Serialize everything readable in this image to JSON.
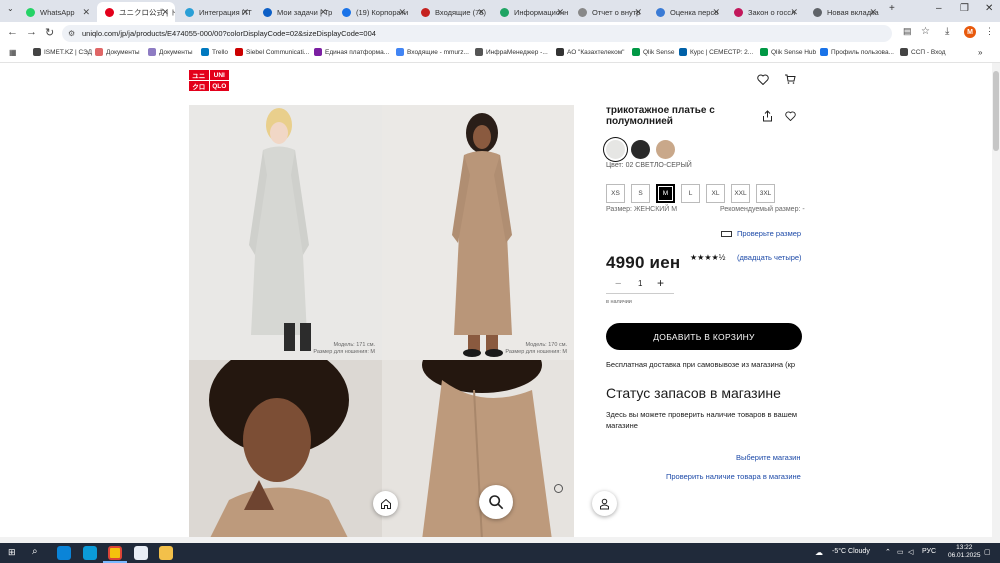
{
  "browser": {
    "tabs": [
      {
        "label": "WhatsApp",
        "color": "#25d366"
      },
      {
        "label": "ユニクロ公式 | ト",
        "color": "#e3001b"
      },
      {
        "label": "Интеграция ИТ",
        "color": "#2a9fd6"
      },
      {
        "label": "Мои задачи | Тр",
        "color": "#0d5fc6"
      },
      {
        "label": "(19) Корпорати",
        "color": "#1a73e8"
      },
      {
        "label": "Входящие (76)",
        "color": "#c5221f"
      },
      {
        "label": "Информационн",
        "color": "#1fa463"
      },
      {
        "label": "Отчет о внутр",
        "color": "#888888"
      },
      {
        "label": "Оценка персо",
        "color": "#3a7bd5"
      },
      {
        "label": "Закон о госсл",
        "color": "#c2185b"
      },
      {
        "label": "Новая вкладка",
        "color": "#5f6368"
      }
    ],
    "url": "uniqlo.com/jp/ja/products/E474055-000/00?colorDisplayCode=02&sizeDisplayCode=004",
    "profile_initial": "M",
    "bookmarks": [
      {
        "label": "ISMET.KZ | СЭД",
        "color": "#444444"
      },
      {
        "label": "Документы",
        "color": "#e06666"
      },
      {
        "label": "Документы",
        "color": "#8e7cc3"
      },
      {
        "label": "Trello",
        "color": "#0079bf"
      },
      {
        "label": "Siebel Communicati...",
        "color": "#cc0000"
      },
      {
        "label": "Единая платформа...",
        "color": "#7b1fa2"
      },
      {
        "label": "Входящие - mmurz...",
        "color": "#4285f4"
      },
      {
        "label": "ИнфраМенеджер -...",
        "color": "#555555"
      },
      {
        "label": "АО \"Казахтелеком\"",
        "color": "#333333"
      },
      {
        "label": "Qlik Sense",
        "color": "#009845"
      },
      {
        "label": "Курс | СЕМЕСТР: 2...",
        "color": "#0061a8"
      },
      {
        "label": "Qlik Sense Hub",
        "color": "#009845"
      },
      {
        "label": "Профиль пользова...",
        "color": "#1a73e8"
      },
      {
        "label": "ССП - Вход",
        "color": "#444444"
      }
    ]
  },
  "site": {
    "logo_cells": [
      "ユニ",
      "UNI",
      "クロ",
      "QLO"
    ],
    "captions": [
      {
        "line1": "Модель: 171 см.",
        "line2": "Размер для ношения: M"
      },
      {
        "line1": "Модель: 170 см.",
        "line2": "Размер для ношения: M"
      }
    ]
  },
  "product": {
    "name": "трикотажное платье с полумолнией",
    "swatches": [
      "#e6e6e4",
      "#2a2a2a",
      "#c9a88a"
    ],
    "color_label": "Цвет: 02 СВЕТЛО-СЕРЫЙ",
    "sizes": [
      "XS",
      "S",
      "M",
      "L",
      "XL",
      "XXL",
      "3XL"
    ],
    "selected_size": "M",
    "size_label": "Размер: ЖЕНСКИЙ M",
    "recommended": "Рекомендуемый размер: -",
    "size_check_link": "Проверьте размер",
    "price": "4990 иен",
    "rating": 4.5,
    "stars": "★★★★½",
    "reviews_link": "(двадцать четыре)",
    "qty_minus": "−",
    "qty_value": "1",
    "qty_plus": "+",
    "stock_note": "в наличии",
    "add_to_cart": "ДОБАВИТЬ В КОРЗИНУ",
    "shipping": "Бесплатная доставка при самовывозе из магазина (кр",
    "stock_title": "Статус запасов в магазине",
    "stock_desc": "Здесь вы можете проверить наличие товаров в вашем магазине",
    "choose_store": "Выберите магазин",
    "check_stock": "Проверить наличие товара в магазине"
  },
  "taskbar": {
    "weather": "-5°C  Cloudy",
    "lang": "РУС",
    "time": "13:22",
    "date": "06.01.2025"
  }
}
